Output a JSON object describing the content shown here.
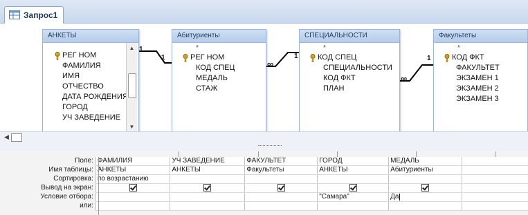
{
  "tab": {
    "title": "Запрос1",
    "icon": "query-icon"
  },
  "tables": [
    {
      "name": "АНКЕТЫ",
      "star": "",
      "fields": [
        "РЕГ НОМ",
        "ФАМИЛИЯ",
        "ИМЯ",
        "ОТЧЕСТВО",
        "ДАТА РОЖДЕНИЯ",
        "ГОРОД",
        "УЧ ЗАВЕДЕНИЕ"
      ],
      "key_field": "РЕГ НОМ"
    },
    {
      "name": "Абитуриенты",
      "star": "*",
      "fields": [
        "РЕГ НОМ",
        "КОД СПЕЦ",
        "МЕДАЛЬ",
        "СТАЖ"
      ],
      "key_field": "РЕГ НОМ"
    },
    {
      "name": "СПЕЦИАЛЬНОСТИ",
      "star": "*",
      "fields": [
        "КОД СПЕЦ",
        "СПЕЦИАЛЬНОСТИ",
        "КОД ФКТ",
        "ПЛАН"
      ],
      "key_field": "КОД СПЕЦ"
    },
    {
      "name": "Факультеты",
      "star": "*",
      "fields": [
        "КОД ФКТ",
        "ФАКУЛЬТЕТ",
        "ЭКЗАМЕН 1",
        "ЭКЗАМЕН 2",
        "ЭКЗАМЕН 3"
      ],
      "key_field": "КОД ФКТ"
    }
  ],
  "joins": [
    {
      "from_label": "1",
      "to_label": "1"
    },
    {
      "from_label": "∞",
      "to_label": "1"
    },
    {
      "from_label": "∞",
      "to_label": "1"
    }
  ],
  "grid": {
    "row_labels": [
      "Поле:",
      "Имя таблицы:",
      "Сортировка:",
      "Вывод на экран:",
      "Условие отбора:",
      "или:"
    ],
    "columns": [
      {
        "field": "ФАМИЛИЯ",
        "table": "АНКЕТЫ",
        "sort": "по возрастанию",
        "show": true,
        "criteria": ""
      },
      {
        "field": "УЧ ЗАВЕДЕНИЕ",
        "table": "АНКЕТЫ",
        "sort": "",
        "show": true,
        "criteria": ""
      },
      {
        "field": "ФАКУЛЬТЕТ",
        "table": "Факультеты",
        "sort": "",
        "show": true,
        "criteria": ""
      },
      {
        "field": "ГОРОД",
        "table": "АНКЕТЫ",
        "sort": "",
        "show": true,
        "criteria": "\"Самара\""
      },
      {
        "field": "МЕДАЛЬ",
        "table": "Абитуриенты",
        "sort": "",
        "show": true,
        "criteria": "Да"
      }
    ]
  },
  "colors": {
    "tab_bg": "#c9d8ee",
    "header_bg": "#b4cbea",
    "key_gold": "#d9a420"
  }
}
